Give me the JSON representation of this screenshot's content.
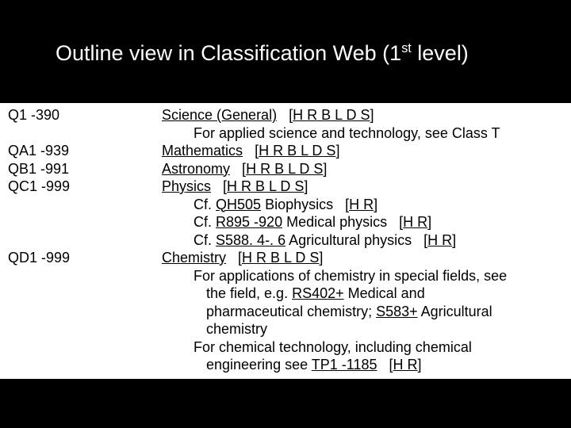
{
  "title": {
    "prefix": "Outline view in Classification Web (1",
    "sup": "st",
    "suffix": " level)"
  },
  "bracket_full": "H R B L D S",
  "bracket_hr": "H R",
  "entries": [
    {
      "code": "Q1 -390",
      "subject": "Science (General)",
      "bracket": "full",
      "notes": [
        {
          "type": "plain",
          "text": "For applied science and technology, see Class T"
        }
      ]
    },
    {
      "code": "QA1 -939",
      "subject": "Mathematics",
      "bracket": "full",
      "notes": []
    },
    {
      "code": "QB1 -991",
      "subject": "Astronomy",
      "bracket": "full",
      "notes": []
    },
    {
      "code": "QC1 -999",
      "subject": "Physics",
      "bracket": "full",
      "notes": [
        {
          "type": "cf",
          "ref": "QH505",
          "text": "Biophysics",
          "bracket": "hr"
        },
        {
          "type": "cf",
          "ref": "R895 -920",
          "text": "Medical physics",
          "bracket": "hr"
        },
        {
          "type": "cf",
          "ref": "S588. 4-. 6",
          "text": "Agricultural physics",
          "bracket": "hr"
        }
      ]
    },
    {
      "code": "QD1 -999",
      "subject": "Chemistry",
      "bracket": "full",
      "notes": [
        {
          "type": "chem1",
          "lead": "For applications of chemistry in special fields, see",
          "cont1a": "the field, e.g. ",
          "ref1": "RS402+",
          "cont1b": " Medical and",
          "cont2a": "pharmaceutical chemistry; ",
          "ref2": "S583+",
          "cont2b": " Agricultural",
          "cont3": "chemistry"
        },
        {
          "type": "chem2",
          "lead": "For chemical technology, including chemical",
          "cont1a": "engineering see ",
          "ref1": "TP1 -1185",
          "bracket": "hr"
        }
      ]
    }
  ]
}
